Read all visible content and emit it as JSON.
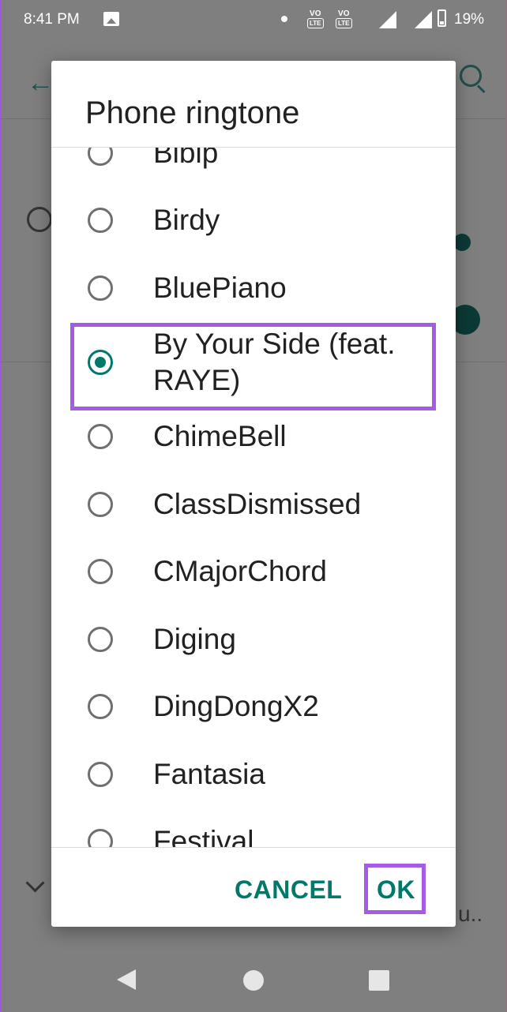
{
  "status_bar": {
    "time": "8:41 PM",
    "sim1_label": "VO",
    "sim1_sub": "LTE",
    "sim2_label": "VO",
    "sim2_sub": "LTE",
    "battery_percent": "19%"
  },
  "background": {
    "truncated_text": "u.."
  },
  "dialog": {
    "title": "Phone ringtone",
    "options": [
      {
        "label": "Bibip",
        "selected": false
      },
      {
        "label": "Birdy",
        "selected": false
      },
      {
        "label": "BluePiano",
        "selected": false
      },
      {
        "label": "By Your Side (feat. RAYE)",
        "selected": true
      },
      {
        "label": "ChimeBell",
        "selected": false
      },
      {
        "label": "ClassDismissed",
        "selected": false
      },
      {
        "label": "CMajorChord",
        "selected": false
      },
      {
        "label": "Diging",
        "selected": false
      },
      {
        "label": "DingDongX2",
        "selected": false
      },
      {
        "label": "Fantasia",
        "selected": false
      },
      {
        "label": "Festival",
        "selected": false
      }
    ],
    "cancel_label": "CANCEL",
    "ok_label": "OK"
  },
  "colors": {
    "accent": "#00796b",
    "highlight": "#a45ce6",
    "scrim": "#7f7f7f"
  },
  "icons": {
    "back": "arrow-left-icon",
    "search": "search-icon",
    "alarm": "alarm-clock-icon",
    "expand": "chevron-down-icon"
  }
}
